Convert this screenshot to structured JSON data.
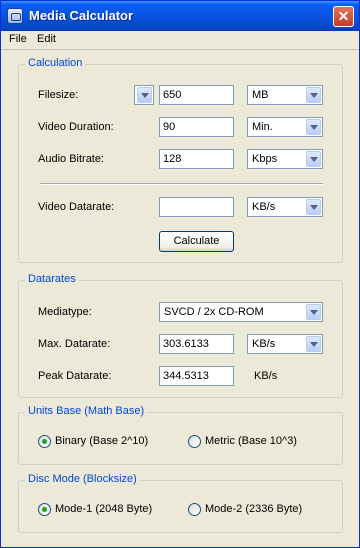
{
  "window": {
    "title": "Media Calculator",
    "close_label": "✕"
  },
  "menu": {
    "file": "File",
    "edit": "Edit"
  },
  "calculation": {
    "legend": "Calculation",
    "filesize_label": "Filesize:",
    "filesize_value": "650",
    "filesize_unit": "MB",
    "duration_label": "Video Duration:",
    "duration_value": "90",
    "duration_unit": "Min.",
    "audio_label": "Audio Bitrate:",
    "audio_value": "128",
    "audio_unit": "Kbps",
    "video_datarate_label": "Video Datarate:",
    "video_datarate_value": "",
    "video_datarate_unit": "KB/s",
    "calculate_button": "Calculate"
  },
  "datarates": {
    "legend": "Datarates",
    "mediatype_label": "Mediatype:",
    "mediatype_value": "SVCD / 2x CD-ROM",
    "max_label": "Max. Datarate:",
    "max_value": "303.6133",
    "max_unit": "KB/s",
    "peak_label": "Peak Datarate:",
    "peak_value": "344.5313",
    "peak_unit": "KB/s"
  },
  "units_base": {
    "legend": "Units Base (Math Base)",
    "binary_label": "Binary (Base 2^10)",
    "metric_label": "Metric (Base 10^3)",
    "selected": "binary"
  },
  "disc_mode": {
    "legend": "Disc Mode (Blocksize)",
    "mode1_label": "Mode-1 (2048 Byte)",
    "mode2_label": "Mode-2 (2336 Byte)",
    "selected": "mode1"
  },
  "colors": {
    "titlebar": "#0853e0",
    "legend_text": "#0046d5",
    "window_bg": "#ece9d8"
  }
}
